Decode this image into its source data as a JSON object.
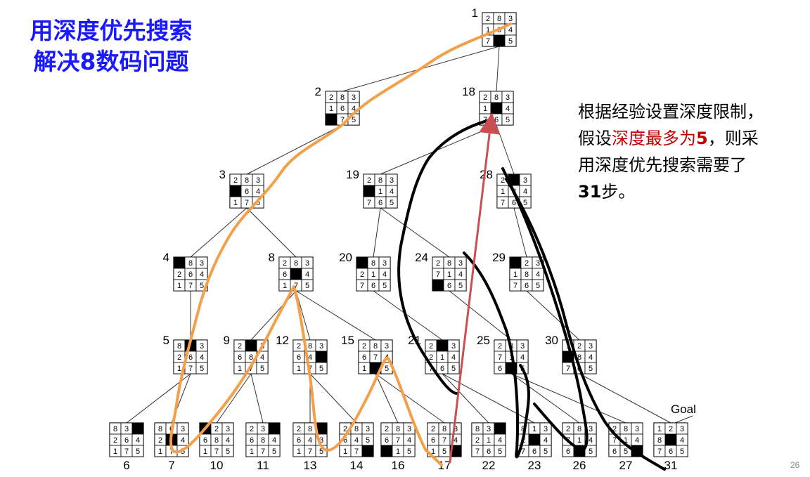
{
  "title": {
    "line1": "用深度优先搜索",
    "line2": "解决8数码问题"
  },
  "annotation": {
    "line1": "根据经验设置深度限制，",
    "line2_pre": "假设",
    "line2_red": "深度最多为",
    "line2_num": "5",
    "line2_post": "，则采",
    "line3": "用深度优先搜索需要了",
    "line4_num": "31",
    "line4_post": "步。"
  },
  "page_number": "26",
  "goal_label": "Goal",
  "nodes": [
    {
      "id": "1",
      "grid": [
        "2",
        "8",
        "3",
        "1",
        "6",
        "4",
        "7",
        "",
        "5"
      ]
    },
    {
      "id": "2",
      "grid": [
        "2",
        "8",
        "3",
        "1",
        "6",
        "4",
        "",
        "7",
        "5"
      ]
    },
    {
      "id": "18",
      "grid": [
        "2",
        "8",
        "3",
        "1",
        "",
        "4",
        "7",
        "6",
        "5"
      ]
    },
    {
      "id": "3",
      "grid": [
        "2",
        "8",
        "3",
        "",
        "6",
        "4",
        "1",
        "7",
        "5"
      ]
    },
    {
      "id": "19",
      "grid": [
        "2",
        "8",
        "3",
        "",
        "1",
        "4",
        "7",
        "6",
        "5"
      ]
    },
    {
      "id": "28",
      "grid": [
        "2",
        "",
        "3",
        "1",
        "8",
        "4",
        "7",
        "6",
        "5"
      ]
    },
    {
      "id": "4",
      "grid": [
        "",
        "8",
        "3",
        "2",
        "6",
        "4",
        "1",
        "7",
        "5"
      ]
    },
    {
      "id": "8",
      "grid": [
        "2",
        "8",
        "3",
        "6",
        "",
        "4",
        "1",
        "7",
        "5"
      ]
    },
    {
      "id": "20",
      "grid": [
        "",
        "8",
        "3",
        "2",
        "1",
        "4",
        "7",
        "6",
        "5"
      ]
    },
    {
      "id": "24",
      "grid": [
        "2",
        "8",
        "3",
        "7",
        "1",
        "4",
        "",
        "6",
        "5"
      ]
    },
    {
      "id": "29",
      "grid": [
        "",
        "2",
        "3",
        "1",
        "8",
        "4",
        "7",
        "6",
        "5"
      ]
    },
    {
      "id": "5",
      "grid": [
        "8",
        "",
        "3",
        "2",
        "6",
        "4",
        "1",
        "7",
        "5"
      ]
    },
    {
      "id": "9",
      "grid": [
        "2",
        "",
        "3",
        "6",
        "8",
        "4",
        "1",
        "7",
        "5"
      ]
    },
    {
      "id": "12",
      "grid": [
        "2",
        "8",
        "3",
        "6",
        "4",
        "",
        "1",
        "7",
        "5"
      ]
    },
    {
      "id": "15",
      "grid": [
        "2",
        "8",
        "3",
        "6",
        "7",
        "4",
        "1",
        "",
        "5"
      ]
    },
    {
      "id": "21",
      "grid": [
        "2",
        "",
        "3",
        "2",
        "1",
        "4",
        "7",
        "6",
        "5"
      ]
    },
    {
      "id": "25",
      "grid": [
        "2",
        "8",
        "3",
        "7",
        "1",
        "4",
        "6",
        "",
        "5"
      ]
    },
    {
      "id": "30",
      "grid": [
        "1",
        "2",
        "3",
        "",
        "8",
        "4",
        "7",
        "6",
        "5"
      ]
    },
    {
      "id": "6",
      "grid": [
        "8",
        "3",
        "",
        "2",
        "6",
        "4",
        "1",
        "7",
        "5"
      ]
    },
    {
      "id": "7",
      "grid": [
        "8",
        "6",
        "3",
        "2",
        "",
        "4",
        "1",
        "7",
        "5"
      ]
    },
    {
      "id": "10",
      "grid": [
        "",
        "2",
        "3",
        "6",
        "8",
        "4",
        "1",
        "7",
        "5"
      ]
    },
    {
      "id": "11",
      "grid": [
        "2",
        "3",
        "",
        "6",
        "8",
        "4",
        "1",
        "7",
        "5"
      ]
    },
    {
      "id": "13",
      "grid": [
        "2",
        "8",
        "",
        "6",
        "4",
        "3",
        "1",
        "7",
        "5"
      ]
    },
    {
      "id": "14",
      "grid": [
        "2",
        "8",
        "3",
        "6",
        "4",
        "5",
        "1",
        "7",
        ""
      ]
    },
    {
      "id": "16",
      "grid": [
        "2",
        "8",
        "3",
        "6",
        "7",
        "4",
        "",
        "1",
        "5"
      ]
    },
    {
      "id": "17",
      "grid": [
        "2",
        "8",
        "3",
        "6",
        "7",
        "4",
        "1",
        "5",
        ""
      ]
    },
    {
      "id": "22",
      "grid": [
        "8",
        "3",
        "",
        "2",
        "1",
        "4",
        "7",
        "6",
        "5"
      ]
    },
    {
      "id": "23",
      "grid": [
        "8",
        "1",
        "3",
        "2",
        "",
        "4",
        "7",
        "6",
        "5"
      ]
    },
    {
      "id": "26",
      "grid": [
        "2",
        "8",
        "3",
        "7",
        "1",
        "4",
        "6",
        "",
        "5"
      ]
    },
    {
      "id": "27",
      "grid": [
        "2",
        "8",
        "3",
        "7",
        "1",
        "4",
        "6",
        "5",
        ""
      ]
    },
    {
      "id": "31",
      "grid": [
        "1",
        "2",
        "3",
        "8",
        "",
        "4",
        "7",
        "6",
        "5"
      ]
    }
  ],
  "colors": {
    "title": "#1a1aff",
    "highlight": "#c00000",
    "path_orange": "#f4a04a",
    "path_black": "#000000",
    "path_red": "#c85050"
  }
}
